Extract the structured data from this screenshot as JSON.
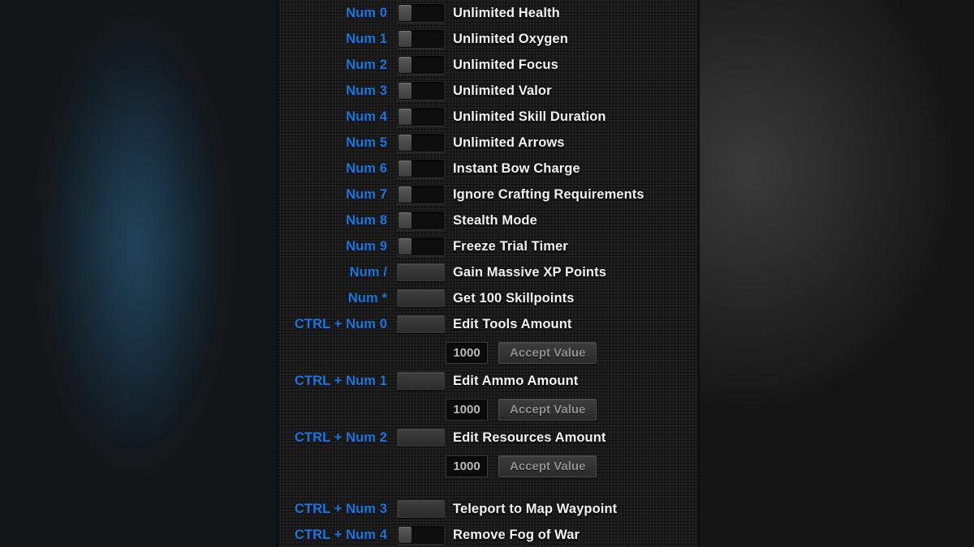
{
  "colors": {
    "hotkey_blue": "#1878e0",
    "label_white": "#f4f4f4",
    "panel_bg": "#1b1b1b",
    "value_text": "#b9b9b9",
    "accept_text": "#8f8f8f"
  },
  "panel": {
    "rows": [
      {
        "kind": "toggle",
        "hotkey": "Num 0",
        "label": "Unlimited Health"
      },
      {
        "kind": "toggle",
        "hotkey": "Num 1",
        "label": "Unlimited Oxygen"
      },
      {
        "kind": "toggle",
        "hotkey": "Num 2",
        "label": "Unlimited Focus"
      },
      {
        "kind": "toggle",
        "hotkey": "Num 3",
        "label": "Unlimited Valor"
      },
      {
        "kind": "toggle",
        "hotkey": "Num 4",
        "label": "Unlimited Skill Duration"
      },
      {
        "kind": "toggle",
        "hotkey": "Num 5",
        "label": "Unlimited Arrows"
      },
      {
        "kind": "toggle",
        "hotkey": "Num 6",
        "label": "Instant Bow Charge"
      },
      {
        "kind": "toggle",
        "hotkey": "Num 7",
        "label": "Ignore Crafting Requirements"
      },
      {
        "kind": "toggle",
        "hotkey": "Num 8",
        "label": "Stealth Mode"
      },
      {
        "kind": "toggle",
        "hotkey": "Num 9",
        "label": "Freeze Trial Timer"
      },
      {
        "kind": "button",
        "hotkey": "Num /",
        "label": "Gain Massive XP Points"
      },
      {
        "kind": "button",
        "hotkey": "Num *",
        "label": "Get 100 Skillpoints"
      },
      {
        "kind": "button",
        "hotkey": "CTRL + Num 0",
        "label": "Edit Tools Amount"
      },
      {
        "kind": "value",
        "value": "1000",
        "accept_label": "Accept Value"
      },
      {
        "kind": "button",
        "hotkey": "CTRL + Num 1",
        "label": "Edit Ammo Amount"
      },
      {
        "kind": "value",
        "value": "1000",
        "accept_label": "Accept Value"
      },
      {
        "kind": "button",
        "hotkey": "CTRL + Num 2",
        "label": "Edit Resources Amount"
      },
      {
        "kind": "value",
        "value": "1000",
        "accept_label": "Accept Value"
      },
      {
        "kind": "gap"
      },
      {
        "kind": "button",
        "hotkey": "CTRL + Num 3",
        "label": "Teleport to Map Waypoint"
      },
      {
        "kind": "toggle",
        "hotkey": "CTRL + Num 4",
        "label": "Remove Fog of War"
      }
    ]
  }
}
